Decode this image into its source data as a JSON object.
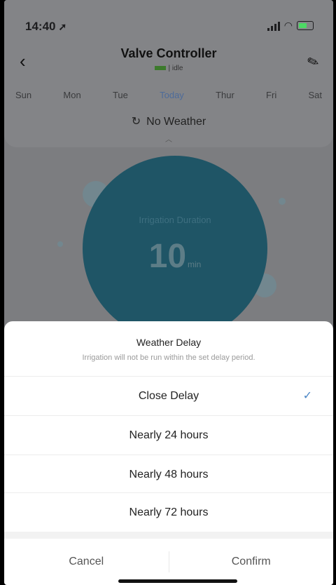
{
  "status_bar": {
    "time": "14:40"
  },
  "header": {
    "title": "Valve Controller",
    "status_text": "| idle",
    "days": [
      {
        "label": "Sun",
        "active": false
      },
      {
        "label": "Mon",
        "active": false
      },
      {
        "label": "Tue",
        "active": false
      },
      {
        "label": "Today",
        "active": true
      },
      {
        "label": "Thur",
        "active": false
      },
      {
        "label": "Fri",
        "active": false
      },
      {
        "label": "Sat",
        "active": false
      }
    ],
    "weather_label": "No Weather"
  },
  "duration": {
    "label": "Irrigation Duration",
    "value": "10",
    "unit": "min"
  },
  "sheet": {
    "title": "Weather Delay",
    "subtitle": "Irrigation will not be run within the set delay period.",
    "options": [
      {
        "label": "Close Delay",
        "selected": true
      },
      {
        "label": "Nearly 24 hours",
        "selected": false
      },
      {
        "label": "Nearly 48 hours",
        "selected": false
      },
      {
        "label": "Nearly 72 hours",
        "selected": false
      }
    ],
    "cancel_label": "Cancel",
    "confirm_label": "Confirm"
  },
  "colors": {
    "accent": "#4a86c5",
    "circle": "#1f5566"
  }
}
